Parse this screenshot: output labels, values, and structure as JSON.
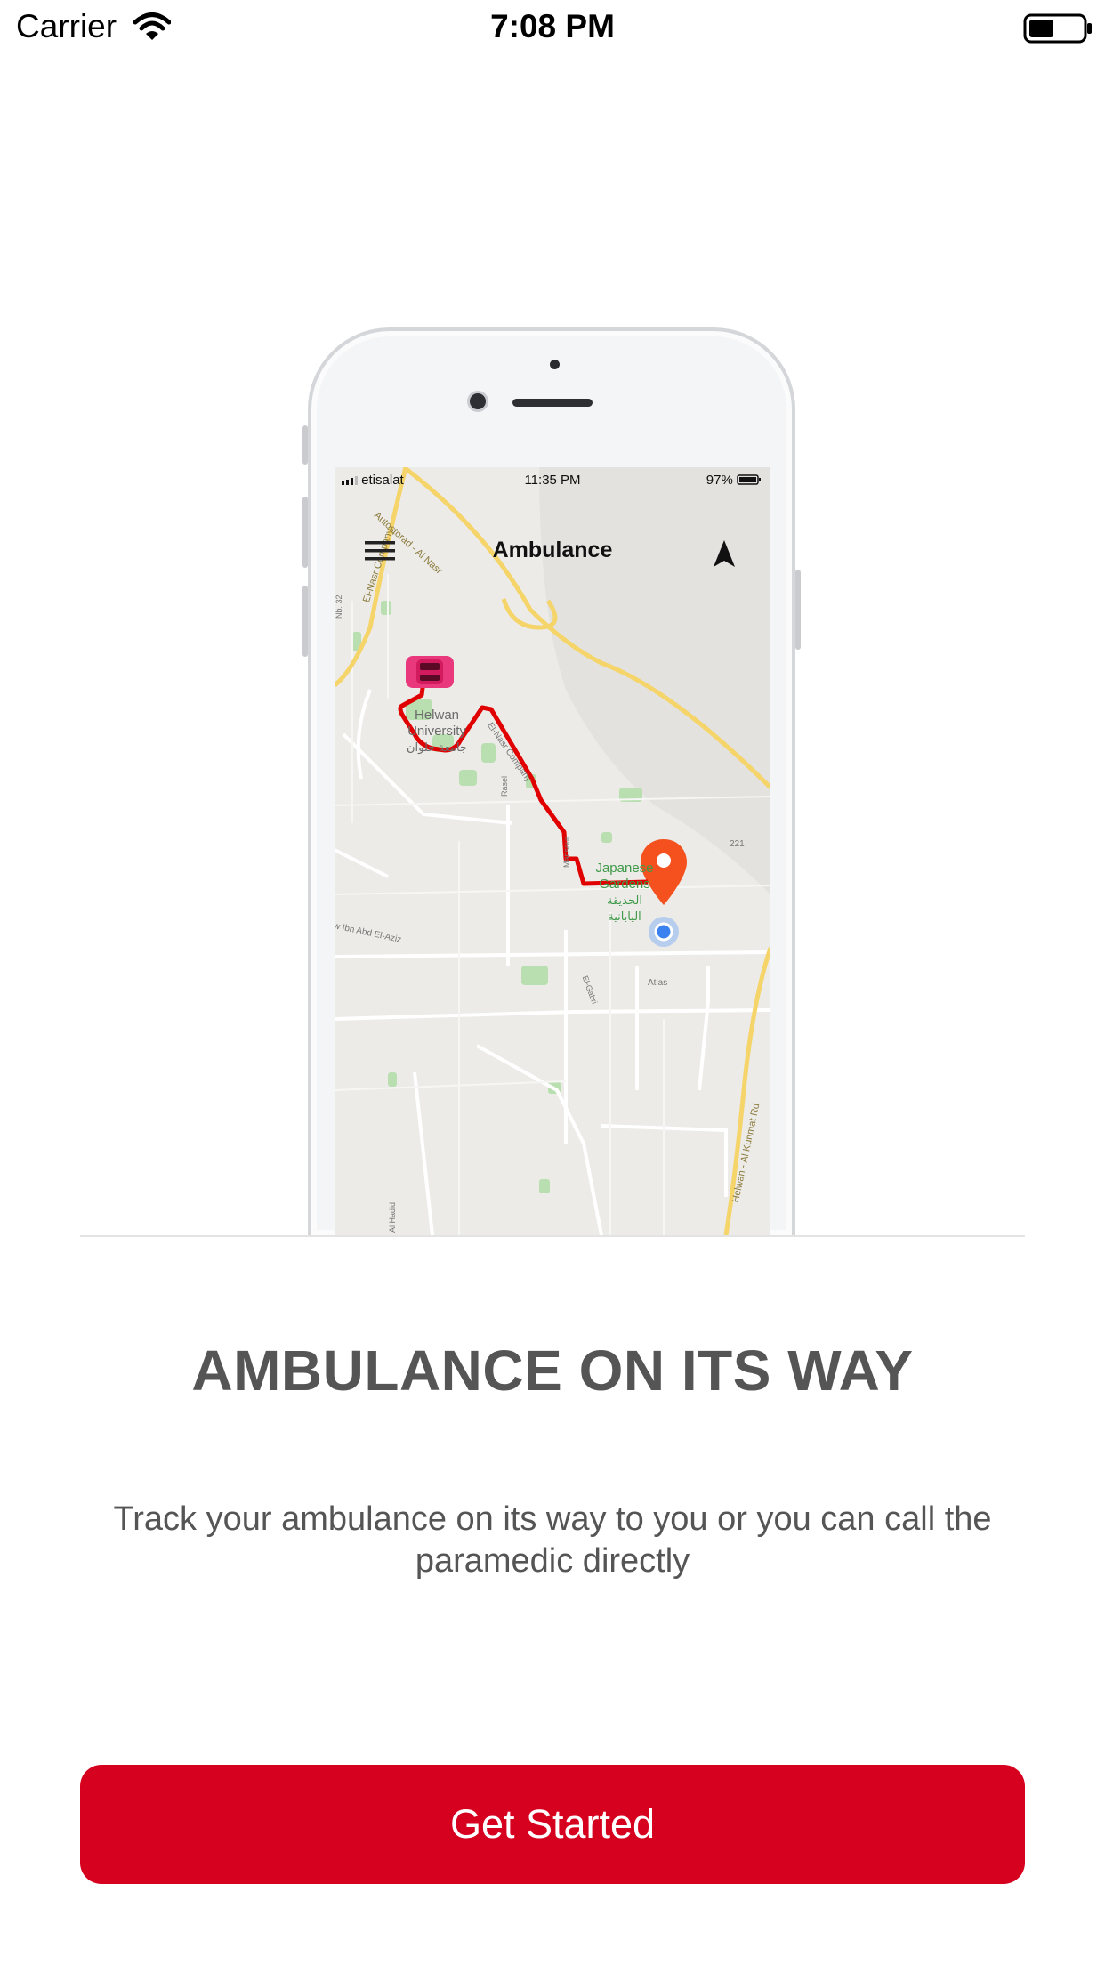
{
  "status_bar": {
    "carrier": "Carrier",
    "time": "7:08 PM",
    "wifi_icon": "wifi-icon",
    "battery_icon": "battery-icon"
  },
  "illustration": {
    "phone_status": {
      "carrier": "etisalat",
      "time": "11:35 PM",
      "battery": "97%"
    },
    "app_title": "Ambulance",
    "menu_icon": "hamburger-menu-icon",
    "nav_icon": "navigation-arrow-icon",
    "map": {
      "labels": {
        "university_en_1": "Helwan",
        "university_en_2": "University",
        "university_ar": "جامعة حلوان",
        "gardens_en_1": "Japanese",
        "gardens_en_2": "Gardens",
        "gardens_ar_1": "الحديقة",
        "gardens_ar_2": "اليابانية",
        "road_autostorad": "Autostorad - Al Nasr",
        "road_elnasr": "El-Nasr Company",
        "road_elnasr2": "El-Nasr Company",
        "road_kurimat": "Helwan - Al Kurimat Rd",
        "road_ibn": "w Ibn Abd El-Aziz",
        "road_221": "221",
        "road_atlas": "Atlas",
        "road_rasel": "Rasel",
        "road_mansour": "Mansour",
        "road_elgabri": "El-Gabri",
        "road_alhadid": "Al Hadid",
        "road_32": "Nb. 32"
      },
      "ambulance_icon": "ambulance-icon",
      "destination_icon": "destination-pin-icon",
      "user_location_icon": "user-location-icon",
      "route_color": "#e00000",
      "pin_color": "#f4511e"
    }
  },
  "onboarding": {
    "title": "AMBULANCE ON ITS WAY",
    "description": "Track your ambulance on its way to you or you can call the paramedic directly"
  },
  "cta": {
    "label": "Get Started",
    "color": "#d6001f"
  }
}
